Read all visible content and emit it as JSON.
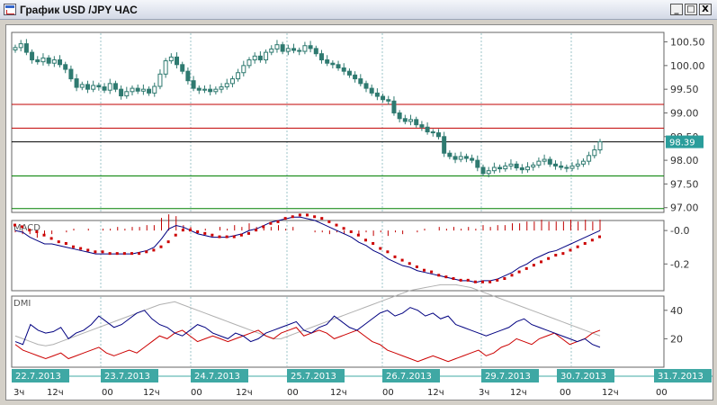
{
  "window": {
    "title": "График USD /JPY  ЧАС",
    "controls": {
      "minimize": "_",
      "maximize": "□",
      "close": "X"
    }
  },
  "price_panel": {
    "y_ticks": [
      "100.50",
      "100.00",
      "99.50",
      "99.00",
      "98.50",
      "98.00",
      "97.50",
      "97.00"
    ],
    "current_price": "98.39",
    "current_price_color": "#2a9d9b",
    "levels": [
      {
        "value": 99.18,
        "color": "#c00000"
      },
      {
        "value": 98.68,
        "color": "#c00000"
      },
      {
        "value": 98.39,
        "color": "#000000"
      },
      {
        "value": 97.67,
        "color": "#008000"
      },
      {
        "value": 96.98,
        "color": "#008000"
      }
    ]
  },
  "macd_panel": {
    "label": "MACD",
    "y_ticks": [
      "-0.0",
      "-0.2"
    ]
  },
  "dmi_panel": {
    "label": "DMI",
    "y_ticks": [
      "40",
      "20"
    ]
  },
  "time_axis": {
    "dates": [
      "22.7.2013",
      "23.7.2013",
      "24.7.2013",
      "25.7.2013",
      "26.7.2013",
      "29.7.2013",
      "30.7.2013",
      "31.7.2013"
    ],
    "hours": [
      "3ч",
      "12ч",
      "00",
      "12ч",
      "00",
      "12ч",
      "00",
      "12ч",
      "00",
      "12ч",
      "3ч",
      "12ч",
      "00",
      "12ч",
      "00"
    ],
    "date_badge_color": "#3fa8a4"
  },
  "chart_data": {
    "type": "candlestick",
    "title": "USD /JPY ЧАС",
    "ylim": [
      96.9,
      100.7
    ],
    "close": [
      100.38,
      100.46,
      100.28,
      100.12,
      100.08,
      100.16,
      100.05,
      100.12,
      100.02,
      99.92,
      99.72,
      99.54,
      99.6,
      99.5,
      99.58,
      99.55,
      99.48,
      99.62,
      99.5,
      99.36,
      99.45,
      99.52,
      99.46,
      99.5,
      99.42,
      99.56,
      99.82,
      100.1,
      100.18,
      100.02,
      99.88,
      99.68,
      99.52,
      99.48,
      99.5,
      99.45,
      99.5,
      99.55,
      99.62,
      99.72,
      99.85,
      100.0,
      100.12,
      100.2,
      100.12,
      100.28,
      100.35,
      100.44,
      100.3,
      100.36,
      100.32,
      100.3,
      100.42,
      100.36,
      100.25,
      100.12,
      100.05,
      100.02,
      99.95,
      99.88,
      99.8,
      99.72,
      99.62,
      99.52,
      99.42,
      99.35,
      99.28,
      99.25,
      99.0,
      98.88,
      98.82,
      98.86,
      98.75,
      98.7,
      98.6,
      98.58,
      98.5,
      98.15,
      98.08,
      98.02,
      98.08,
      98.04,
      98.0,
      97.85,
      97.72,
      97.78,
      97.85,
      97.82,
      97.88,
      97.92,
      97.84,
      97.8,
      97.86,
      97.9,
      97.98,
      98.02,
      97.92,
      97.88,
      97.85,
      97.83,
      97.88,
      97.92,
      97.98,
      98.1,
      98.22,
      98.39
    ],
    "macd": {
      "y_ticks": [
        0.0,
        -0.2
      ],
      "ylim": [
        -0.36,
        0.06
      ],
      "macd_line": [
        0.0,
        -0.01,
        -0.04,
        -0.06,
        -0.08,
        -0.08,
        -0.09,
        -0.1,
        -0.11,
        -0.12,
        -0.13,
        -0.14,
        -0.14,
        -0.14,
        -0.14,
        -0.14,
        -0.14,
        -0.13,
        -0.12,
        -0.1,
        -0.05,
        0.01,
        0.03,
        0.02,
        0.0,
        -0.02,
        -0.03,
        -0.04,
        -0.04,
        -0.04,
        -0.03,
        -0.02,
        0.0,
        0.01,
        0.03,
        0.05,
        0.06,
        0.07,
        0.08,
        0.08,
        0.07,
        0.06,
        0.04,
        0.02,
        0.0,
        -0.02,
        -0.04,
        -0.07,
        -0.09,
        -0.12,
        -0.14,
        -0.17,
        -0.19,
        -0.21,
        -0.22,
        -0.24,
        -0.25,
        -0.26,
        -0.27,
        -0.28,
        -0.29,
        -0.3,
        -0.3,
        -0.31,
        -0.3,
        -0.3,
        -0.29,
        -0.27,
        -0.25,
        -0.22,
        -0.2,
        -0.17,
        -0.15,
        -0.13,
        -0.12,
        -0.1,
        -0.08,
        -0.06,
        -0.04,
        -0.02,
        0.0
      ],
      "signal_line": [
        0.03,
        0.02,
        0.0,
        -0.01,
        -0.03,
        -0.05,
        -0.07,
        -0.08,
        -0.1,
        -0.11,
        -0.12,
        -0.13,
        -0.13,
        -0.14,
        -0.14,
        -0.14,
        -0.14,
        -0.14,
        -0.13,
        -0.12,
        -0.1,
        -0.07,
        -0.03,
        0.0,
        0.0,
        -0.01,
        -0.02,
        -0.03,
        -0.04,
        -0.04,
        -0.04,
        -0.03,
        -0.02,
        0.0,
        0.02,
        0.04,
        0.05,
        0.07,
        0.08,
        0.09,
        0.09,
        0.08,
        0.07,
        0.05,
        0.03,
        0.01,
        -0.01,
        -0.03,
        -0.06,
        -0.08,
        -0.11,
        -0.13,
        -0.16,
        -0.18,
        -0.2,
        -0.22,
        -0.24,
        -0.25,
        -0.27,
        -0.28,
        -0.29,
        -0.3,
        -0.3,
        -0.31,
        -0.31,
        -0.31,
        -0.3,
        -0.29,
        -0.27,
        -0.25,
        -0.23,
        -0.21,
        -0.19,
        -0.17,
        -0.15,
        -0.14,
        -0.12,
        -0.1,
        -0.08,
        -0.06,
        -0.04
      ]
    },
    "dmi": {
      "y_ticks": [
        40,
        20
      ],
      "ylim": [
        0,
        50
      ],
      "plus_di": [
        18,
        16,
        30,
        26,
        24,
        25,
        28,
        20,
        24,
        26,
        30,
        36,
        32,
        28,
        30,
        34,
        38,
        40,
        34,
        30,
        28,
        24,
        22,
        26,
        30,
        28,
        24,
        22,
        20,
        24,
        22,
        18,
        20,
        24,
        26,
        28,
        30,
        32,
        26,
        24,
        28,
        30,
        36,
        32,
        28,
        26,
        30,
        34,
        38,
        40,
        36,
        38,
        42,
        40,
        36,
        38,
        34,
        36,
        30,
        28,
        26,
        24,
        22,
        24,
        26,
        28,
        32,
        34,
        30,
        28,
        26,
        24,
        22,
        20,
        18,
        20,
        16,
        14
      ],
      "minus_di": [
        16,
        12,
        10,
        8,
        6,
        8,
        10,
        6,
        8,
        10,
        12,
        14,
        10,
        8,
        10,
        12,
        10,
        14,
        18,
        22,
        20,
        24,
        26,
        22,
        18,
        20,
        22,
        20,
        18,
        20,
        22,
        24,
        26,
        22,
        20,
        24,
        26,
        28,
        22,
        24,
        26,
        24,
        20,
        22,
        24,
        26,
        22,
        18,
        16,
        12,
        10,
        8,
        6,
        4,
        6,
        8,
        6,
        4,
        6,
        8,
        10,
        12,
        8,
        10,
        14,
        16,
        20,
        18,
        16,
        20,
        22,
        24,
        20,
        16,
        18,
        20,
        24,
        26
      ],
      "adx": [
        22,
        20,
        18,
        16,
        15,
        16,
        18,
        20,
        22,
        24,
        26,
        28,
        30,
        32,
        34,
        36,
        38,
        40,
        42,
        44,
        45,
        46,
        44,
        42,
        40,
        38,
        36,
        34,
        32,
        30,
        28,
        26,
        24,
        22,
        20,
        20,
        22,
        24,
        26,
        28,
        30,
        32,
        34,
        36,
        38,
        40,
        42,
        44,
        46,
        48,
        50,
        52,
        54,
        55,
        56,
        57,
        58,
        58,
        58,
        57,
        56,
        54,
        52,
        50,
        48,
        46,
        44,
        42,
        40,
        38,
        36,
        34,
        32,
        30,
        28,
        26,
        24,
        22
      ]
    }
  }
}
